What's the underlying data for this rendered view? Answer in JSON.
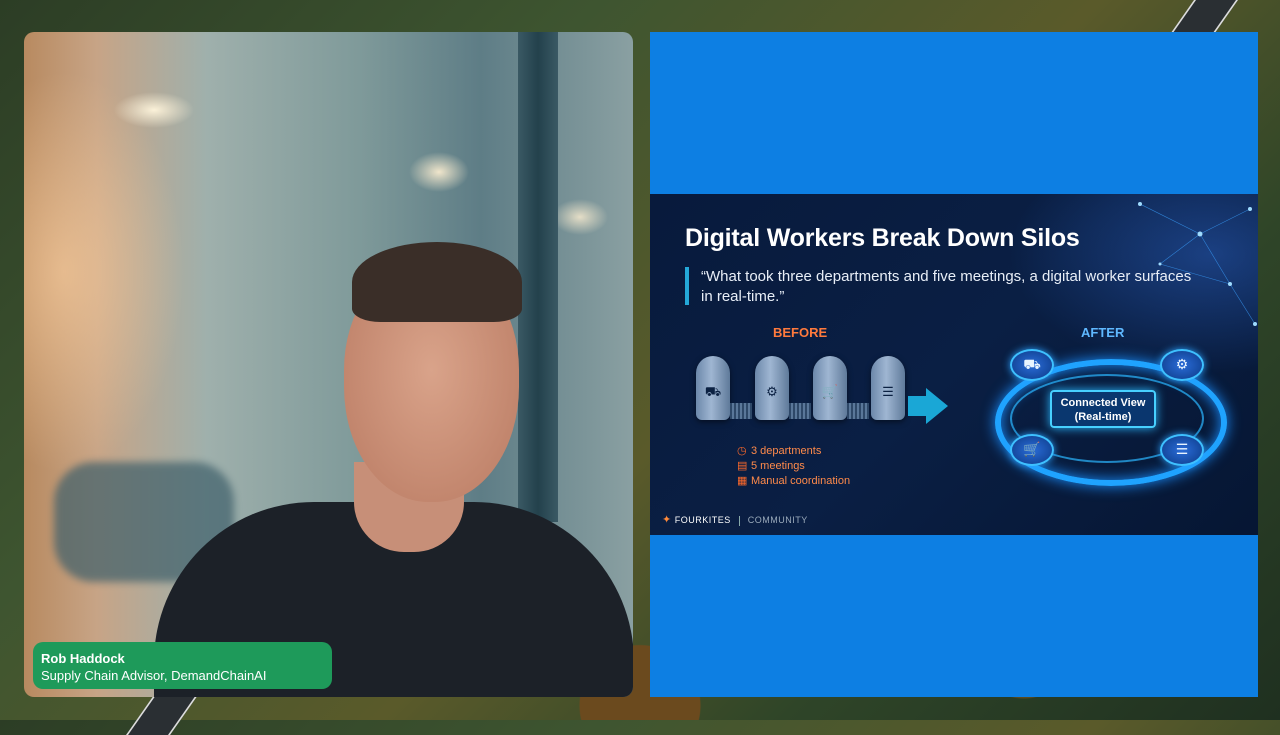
{
  "speaker": {
    "name": "Rob Haddock",
    "title": "Supply Chain Advisor, DemandChainAI"
  },
  "slide": {
    "title": "Digital Workers Break Down Silos",
    "quote": "“What took three departments and five meetings, a digital worker surfaces in real-time.”",
    "before_label": "BEFORE",
    "after_label": "AFTER",
    "before_bullets": [
      "3 departments",
      "5 meetings",
      "Manual coordination"
    ],
    "connected_view_line1": "Connected View",
    "connected_view_line2": "(Real-time)",
    "logo_brand": "FOURKITES",
    "logo_community": "COMMUNITY"
  },
  "colors": {
    "nametag": "#1e9a5a",
    "panel": "#0d7fe3",
    "slide_bg": "#0a1f44",
    "before_accent": "#ff7a3d",
    "after_accent": "#5fb8ff"
  },
  "icons": {
    "silos": [
      "truck-icon",
      "gears-icon",
      "cart-icon",
      "coins-icon"
    ],
    "bullets": [
      "clock-icon",
      "calendar-icon",
      "document-icon"
    ],
    "nodes": [
      "truck-icon",
      "gears-icon",
      "cart-icon",
      "coins-icon"
    ]
  }
}
